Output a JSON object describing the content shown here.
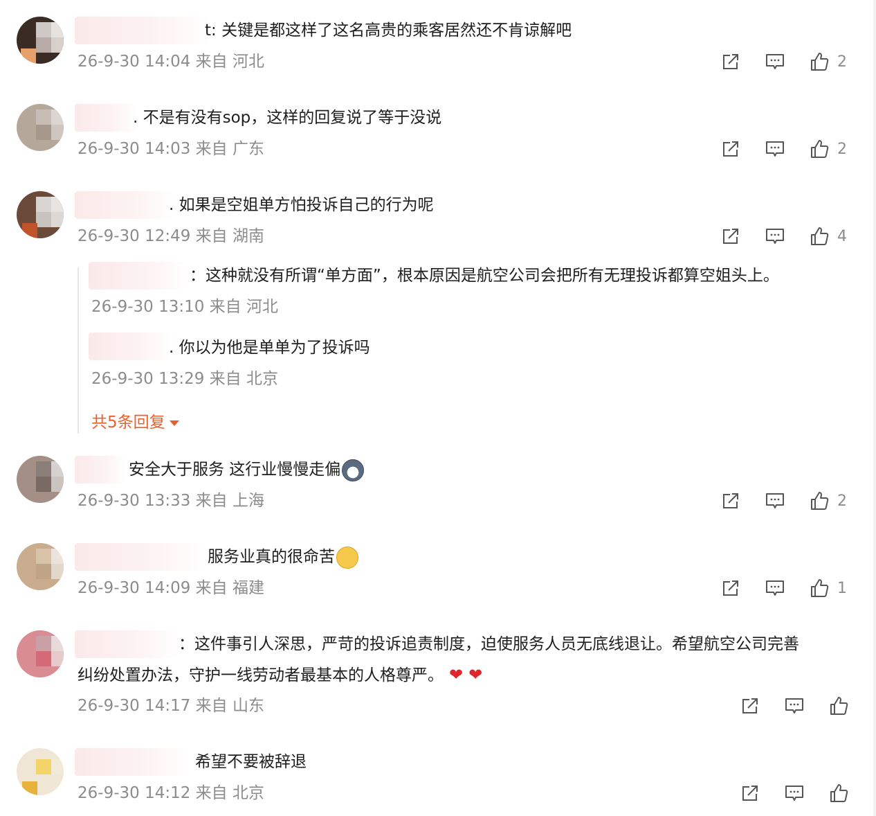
{
  "comments": [
    {
      "text": "t: 关键是都这样了这名高贵的乘客居然还不肯谅解吧",
      "time": "26-9-30 14:04",
      "from": "来自",
      "loc": "河北",
      "likes": "2"
    },
    {
      "text": ". 不是有没有sop，这样的回复说了等于没说",
      "time": "26-9-30 14:03",
      "from": "来自",
      "loc": "广东",
      "likes": "2"
    },
    {
      "text": ". 如果是空姐单方怕投诉自己的行为呢",
      "time": "26-9-30 12:49",
      "from": "来自",
      "loc": "湖南",
      "likes": "4"
    },
    {
      "text": "安全大于服务 这行业慢慢走偏",
      "time": "26-9-30 13:33",
      "from": "来自",
      "loc": "上海",
      "likes": "2"
    },
    {
      "text": "服务业真的很命苦",
      "time": "26-9-30 14:09",
      "from": "来自",
      "loc": "福建",
      "likes": "1"
    },
    {
      "text_line1": "：这件事引人深思，严苛的投诉追责制度，迫使服务人员无底线退让。希望航空公司完善",
      "text_line2": "纠纷处置办法，守护一线劳动者最基本的人格尊严。",
      "time": "26-9-30 14:17",
      "from": "来自",
      "loc": "山东",
      "likes": ""
    },
    {
      "text": "希望不要被辞退",
      "time": "26-9-30 14:12",
      "from": "来自",
      "loc": "北京",
      "likes": ""
    }
  ],
  "replies": [
    {
      "text": "：这种就没有所谓“单方面”，根本原因是航空公司会把所有无理投诉都算空姐头上。",
      "time": "26-9-30 13:10",
      "from": "来自",
      "loc": "河北"
    },
    {
      "text": ". 你以为他是单单为了投诉吗",
      "time": "26-9-30 13:29",
      "from": "来自",
      "loc": "北京"
    }
  ],
  "more_replies": "共5条回复",
  "icons": {
    "share": "share-icon",
    "comment": "comment-icon",
    "like": "like-icon"
  },
  "colors": {
    "accent": "#e8612c",
    "meta": "#8c8c8c",
    "heart": "#e0262b"
  }
}
